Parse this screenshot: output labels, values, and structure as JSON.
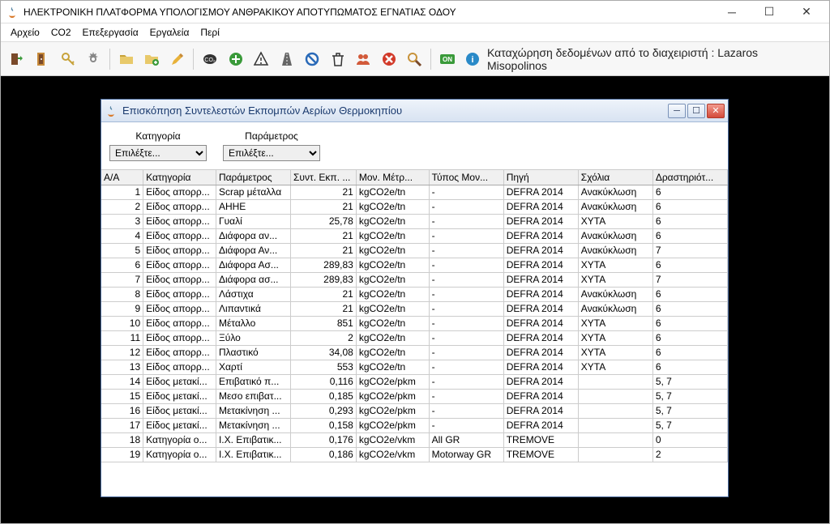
{
  "window": {
    "title": "ΗΛΕΚΤΡΟΝΙΚΗ ΠΛΑΤΦΟΡΜΑ ΥΠΟΛΟΓΙΣΜΟΥ ΑΝΘΡΑΚΙΚΟΥ ΑΠΟΤΥΠΩΜΑΤΟΣ ΕΓΝΑΤΙΑΣ ΟΔΟΥ"
  },
  "menu": [
    "Αρχείο",
    "CO2",
    "Επεξεργασία",
    "Εργαλεία",
    "Περί"
  ],
  "toolbar_icons": [
    "exit-icon",
    "door-icon",
    "key-icon",
    "gear-icon",
    "sep",
    "folder-icon",
    "folder-add-icon",
    "pencil-icon",
    "sep",
    "co2-icon",
    "plus-green-icon",
    "warning-icon",
    "road-icon",
    "ban-blue-icon",
    "trash-icon",
    "people-icon",
    "ban-red-icon",
    "search-icon",
    "sep",
    "on-icon",
    "info-icon"
  ],
  "status_right": "Καταχώρηση δεδομένων από το διαχειριστή : Lazaros Misopolinos",
  "inner": {
    "title": "Επισκόπηση Συντελεστών Εκπομπών Αερίων Θερμοκηπίου",
    "filter1_label": "Κατηγορία",
    "filter2_label": "Παράμετρος",
    "filter_placeholder": "Επιλέξτε..."
  },
  "columns": [
    "Α/Α",
    "Κατηγορία",
    "Παράμετρος",
    "Συντ. Εκπ. ...",
    "Μον. Μέτρ...",
    "Τύπος Μον...",
    "Πηγή",
    "Σχόλια",
    "Δραστηριότ..."
  ],
  "rows": [
    {
      "aa": "1",
      "cat": "Είδος απορρ...",
      "par": "Scrap μέταλλα",
      "syn": "21",
      "mon": "kgCO2e/tn",
      "typ": "-",
      "src": "DEFRA 2014",
      "com": "Ανακύκλωση",
      "act": "6"
    },
    {
      "aa": "2",
      "cat": "Είδος απορρ...",
      "par": "ΑΗΗΕ",
      "syn": "21",
      "mon": "kgCO2e/tn",
      "typ": "-",
      "src": "DEFRA 2014",
      "com": "Ανακύκλωση",
      "act": "6"
    },
    {
      "aa": "3",
      "cat": "Είδος απορρ...",
      "par": "Γυαλί",
      "syn": "25,78",
      "mon": "kgCO2e/tn",
      "typ": "-",
      "src": "DEFRA 2014",
      "com": "ΧΥΤΑ",
      "act": "6"
    },
    {
      "aa": "4",
      "cat": "Είδος απορρ...",
      "par": "Διάφορα αν...",
      "syn": "21",
      "mon": "kgCO2e/tn",
      "typ": "-",
      "src": "DEFRA 2014",
      "com": "Ανακύκλωση",
      "act": "6"
    },
    {
      "aa": "5",
      "cat": "Είδος απορρ...",
      "par": "Διάφορα Αν...",
      "syn": "21",
      "mon": "kgCO2e/tn",
      "typ": "-",
      "src": "DEFRA 2014",
      "com": "Ανακύκλωση",
      "act": "7"
    },
    {
      "aa": "6",
      "cat": "Είδος απορρ...",
      "par": "Διάφορα Ασ...",
      "syn": "289,83",
      "mon": "kgCO2e/tn",
      "typ": "-",
      "src": "DEFRA 2014",
      "com": "ΧΥΤΑ",
      "act": "6"
    },
    {
      "aa": "7",
      "cat": "Είδος απορρ...",
      "par": "Διάφορα ασ...",
      "syn": "289,83",
      "mon": "kgCO2e/tn",
      "typ": "-",
      "src": "DEFRA 2014",
      "com": "ΧΥΤΑ",
      "act": "7"
    },
    {
      "aa": "8",
      "cat": "Είδος απορρ...",
      "par": "Λάστιχα",
      "syn": "21",
      "mon": "kgCO2e/tn",
      "typ": "-",
      "src": "DEFRA 2014",
      "com": "Ανακύκλωση",
      "act": "6"
    },
    {
      "aa": "9",
      "cat": "Είδος απορρ...",
      "par": "Λιπαντικά",
      "syn": "21",
      "mon": "kgCO2e/tn",
      "typ": "-",
      "src": "DEFRA 2014",
      "com": "Ανακύκλωση",
      "act": "6"
    },
    {
      "aa": "10",
      "cat": "Είδος απορρ...",
      "par": "Μέταλλο",
      "syn": "851",
      "mon": "kgCO2e/tn",
      "typ": "-",
      "src": "DEFRA 2014",
      "com": "ΧΥΤΑ",
      "act": "6"
    },
    {
      "aa": "11",
      "cat": "Είδος απορρ...",
      "par": "Ξύλο",
      "syn": "2",
      "mon": "kgCO2e/tn",
      "typ": "-",
      "src": "DEFRA 2014",
      "com": "ΧΥΤΑ",
      "act": "6"
    },
    {
      "aa": "12",
      "cat": "Είδος απορρ...",
      "par": "Πλαστικό",
      "syn": "34,08",
      "mon": "kgCO2e/tn",
      "typ": "-",
      "src": "DEFRA 2014",
      "com": "ΧΥΤΑ",
      "act": "6"
    },
    {
      "aa": "13",
      "cat": "Είδος απορρ...",
      "par": "Χαρτί",
      "syn": "553",
      "mon": "kgCO2e/tn",
      "typ": "-",
      "src": "DEFRA 2014",
      "com": "ΧΥΤΑ",
      "act": "6"
    },
    {
      "aa": "14",
      "cat": "Είδος μετακί...",
      "par": "Επιβατικό π...",
      "syn": "0,116",
      "mon": "kgCO2e/pkm",
      "typ": "-",
      "src": "DEFRA 2014",
      "com": "",
      "act": "5, 7"
    },
    {
      "aa": "15",
      "cat": "Είδος μετακί...",
      "par": "Μεσο επιβατ...",
      "syn": "0,185",
      "mon": "kgCO2e/pkm",
      "typ": "-",
      "src": "DEFRA 2014",
      "com": "",
      "act": "5, 7"
    },
    {
      "aa": "16",
      "cat": "Είδος μετακί...",
      "par": "Μετακίνηση ...",
      "syn": "0,293",
      "mon": "kgCO2e/pkm",
      "typ": "-",
      "src": "DEFRA 2014",
      "com": "",
      "act": "5, 7"
    },
    {
      "aa": "17",
      "cat": "Είδος μετακί...",
      "par": "Μετακίνηση ...",
      "syn": "0,158",
      "mon": "kgCO2e/pkm",
      "typ": "-",
      "src": "DEFRA 2014",
      "com": "",
      "act": "5, 7"
    },
    {
      "aa": "18",
      "cat": "Κατηγορία ο...",
      "par": "Ι.Χ. Επιβατικ...",
      "syn": "0,176",
      "mon": "kgCO2e/vkm",
      "typ": "All GR",
      "src": "TREMOVE",
      "com": "",
      "act": "0"
    },
    {
      "aa": "19",
      "cat": "Κατηγορία ο...",
      "par": "Ι.Χ. Επιβατικ...",
      "syn": "0,186",
      "mon": "kgCO2e/vkm",
      "typ": "Motorway GR",
      "src": "TREMOVE",
      "com": "",
      "act": "2"
    }
  ]
}
